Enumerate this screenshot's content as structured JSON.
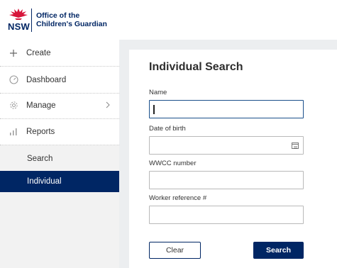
{
  "header": {
    "brand_short": "NSW",
    "org_line1": "Office of the",
    "org_line2": "Children's Guardian"
  },
  "sidebar": {
    "items": [
      {
        "label": "Create",
        "icon": "plus-icon"
      },
      {
        "label": "Dashboard",
        "icon": "gauge-icon"
      },
      {
        "label": "Manage",
        "icon": "gear-icon"
      },
      {
        "label": "Reports",
        "icon": "bar-chart-icon"
      }
    ],
    "sub_items": [
      {
        "label": "Search"
      },
      {
        "label": "Individual",
        "active": true
      }
    ]
  },
  "main": {
    "title": "Individual Search",
    "fields": [
      {
        "label": "Name",
        "value": ""
      },
      {
        "label": "Date of birth",
        "value": ""
      },
      {
        "label": "WWCC number",
        "value": ""
      },
      {
        "label": "Worker reference #",
        "value": ""
      }
    ],
    "buttons": {
      "clear": "Clear",
      "search": "Search"
    }
  },
  "colors": {
    "brand_navy": "#002664",
    "brand_red": "#d7153a",
    "panel_bg": "#eceef0",
    "sidebar_sub_bg": "#f2f2f2"
  }
}
